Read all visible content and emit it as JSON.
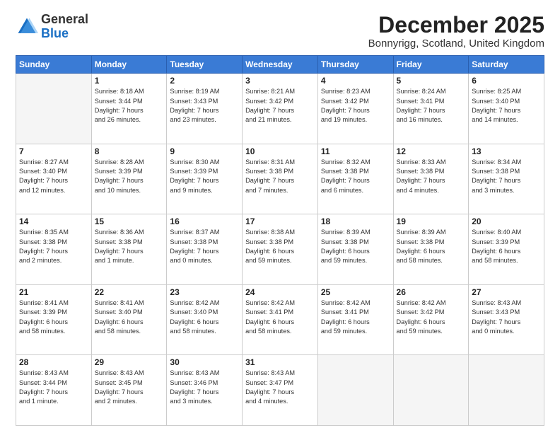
{
  "header": {
    "logo": {
      "line1": "General",
      "line2": "Blue"
    },
    "title": "December 2025",
    "location": "Bonnyrigg, Scotland, United Kingdom"
  },
  "days_of_week": [
    "Sunday",
    "Monday",
    "Tuesday",
    "Wednesday",
    "Thursday",
    "Friday",
    "Saturday"
  ],
  "weeks": [
    [
      {
        "day": "",
        "info": ""
      },
      {
        "day": "1",
        "info": "Sunrise: 8:18 AM\nSunset: 3:44 PM\nDaylight: 7 hours\nand 26 minutes."
      },
      {
        "day": "2",
        "info": "Sunrise: 8:19 AM\nSunset: 3:43 PM\nDaylight: 7 hours\nand 23 minutes."
      },
      {
        "day": "3",
        "info": "Sunrise: 8:21 AM\nSunset: 3:42 PM\nDaylight: 7 hours\nand 21 minutes."
      },
      {
        "day": "4",
        "info": "Sunrise: 8:23 AM\nSunset: 3:42 PM\nDaylight: 7 hours\nand 19 minutes."
      },
      {
        "day": "5",
        "info": "Sunrise: 8:24 AM\nSunset: 3:41 PM\nDaylight: 7 hours\nand 16 minutes."
      },
      {
        "day": "6",
        "info": "Sunrise: 8:25 AM\nSunset: 3:40 PM\nDaylight: 7 hours\nand 14 minutes."
      }
    ],
    [
      {
        "day": "7",
        "info": "Sunrise: 8:27 AM\nSunset: 3:40 PM\nDaylight: 7 hours\nand 12 minutes."
      },
      {
        "day": "8",
        "info": "Sunrise: 8:28 AM\nSunset: 3:39 PM\nDaylight: 7 hours\nand 10 minutes."
      },
      {
        "day": "9",
        "info": "Sunrise: 8:30 AM\nSunset: 3:39 PM\nDaylight: 7 hours\nand 9 minutes."
      },
      {
        "day": "10",
        "info": "Sunrise: 8:31 AM\nSunset: 3:38 PM\nDaylight: 7 hours\nand 7 minutes."
      },
      {
        "day": "11",
        "info": "Sunrise: 8:32 AM\nSunset: 3:38 PM\nDaylight: 7 hours\nand 6 minutes."
      },
      {
        "day": "12",
        "info": "Sunrise: 8:33 AM\nSunset: 3:38 PM\nDaylight: 7 hours\nand 4 minutes."
      },
      {
        "day": "13",
        "info": "Sunrise: 8:34 AM\nSunset: 3:38 PM\nDaylight: 7 hours\nand 3 minutes."
      }
    ],
    [
      {
        "day": "14",
        "info": "Sunrise: 8:35 AM\nSunset: 3:38 PM\nDaylight: 7 hours\nand 2 minutes."
      },
      {
        "day": "15",
        "info": "Sunrise: 8:36 AM\nSunset: 3:38 PM\nDaylight: 7 hours\nand 1 minute."
      },
      {
        "day": "16",
        "info": "Sunrise: 8:37 AM\nSunset: 3:38 PM\nDaylight: 7 hours\nand 0 minutes."
      },
      {
        "day": "17",
        "info": "Sunrise: 8:38 AM\nSunset: 3:38 PM\nDaylight: 6 hours\nand 59 minutes."
      },
      {
        "day": "18",
        "info": "Sunrise: 8:39 AM\nSunset: 3:38 PM\nDaylight: 6 hours\nand 59 minutes."
      },
      {
        "day": "19",
        "info": "Sunrise: 8:39 AM\nSunset: 3:38 PM\nDaylight: 6 hours\nand 58 minutes."
      },
      {
        "day": "20",
        "info": "Sunrise: 8:40 AM\nSunset: 3:39 PM\nDaylight: 6 hours\nand 58 minutes."
      }
    ],
    [
      {
        "day": "21",
        "info": "Sunrise: 8:41 AM\nSunset: 3:39 PM\nDaylight: 6 hours\nand 58 minutes."
      },
      {
        "day": "22",
        "info": "Sunrise: 8:41 AM\nSunset: 3:40 PM\nDaylight: 6 hours\nand 58 minutes."
      },
      {
        "day": "23",
        "info": "Sunrise: 8:42 AM\nSunset: 3:40 PM\nDaylight: 6 hours\nand 58 minutes."
      },
      {
        "day": "24",
        "info": "Sunrise: 8:42 AM\nSunset: 3:41 PM\nDaylight: 6 hours\nand 58 minutes."
      },
      {
        "day": "25",
        "info": "Sunrise: 8:42 AM\nSunset: 3:41 PM\nDaylight: 6 hours\nand 59 minutes."
      },
      {
        "day": "26",
        "info": "Sunrise: 8:42 AM\nSunset: 3:42 PM\nDaylight: 6 hours\nand 59 minutes."
      },
      {
        "day": "27",
        "info": "Sunrise: 8:43 AM\nSunset: 3:43 PM\nDaylight: 7 hours\nand 0 minutes."
      }
    ],
    [
      {
        "day": "28",
        "info": "Sunrise: 8:43 AM\nSunset: 3:44 PM\nDaylight: 7 hours\nand 1 minute."
      },
      {
        "day": "29",
        "info": "Sunrise: 8:43 AM\nSunset: 3:45 PM\nDaylight: 7 hours\nand 2 minutes."
      },
      {
        "day": "30",
        "info": "Sunrise: 8:43 AM\nSunset: 3:46 PM\nDaylight: 7 hours\nand 3 minutes."
      },
      {
        "day": "31",
        "info": "Sunrise: 8:43 AM\nSunset: 3:47 PM\nDaylight: 7 hours\nand 4 minutes."
      },
      {
        "day": "",
        "info": ""
      },
      {
        "day": "",
        "info": ""
      },
      {
        "day": "",
        "info": ""
      }
    ]
  ]
}
